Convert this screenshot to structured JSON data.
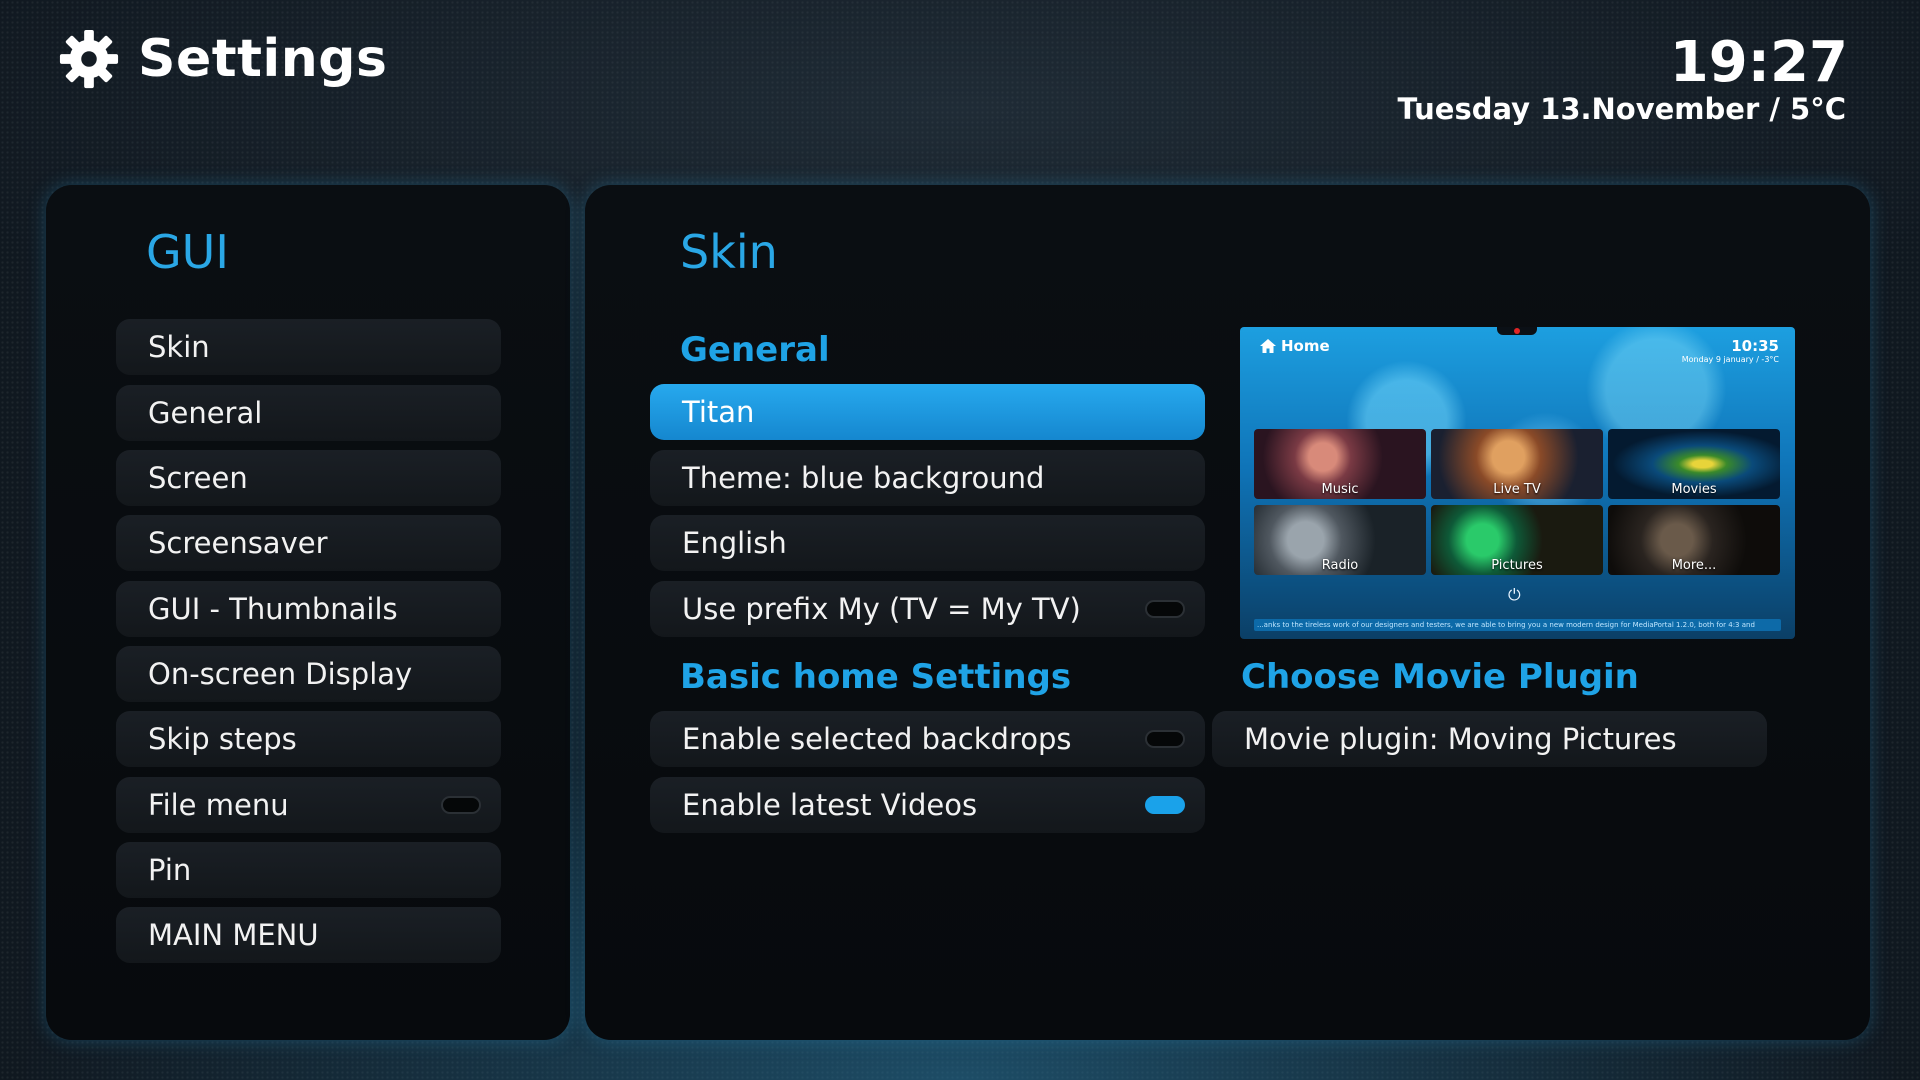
{
  "header": {
    "title": "Settings",
    "icon": "gear-icon",
    "time": "19:27",
    "date": "Tuesday 13.November / 5°C"
  },
  "left_panel": {
    "heading": "GUI",
    "items": [
      {
        "label": "Skin"
      },
      {
        "label": "General"
      },
      {
        "label": "Screen"
      },
      {
        "label": "Screensaver"
      },
      {
        "label": "GUI - Thumbnails"
      },
      {
        "label": "On-screen Display"
      },
      {
        "label": "Skip steps"
      },
      {
        "label": "File menu",
        "toggle": "off"
      },
      {
        "label": "Pin"
      },
      {
        "label": "MAIN MENU"
      }
    ]
  },
  "right_panel": {
    "heading": "Skin",
    "general": {
      "title": "General",
      "items": [
        {
          "label": "Titan",
          "selected": true
        },
        {
          "label": "Theme: blue background"
        },
        {
          "label": "English"
        },
        {
          "label": "Use prefix My (TV = My TV)",
          "toggle": "off"
        }
      ]
    },
    "basic_home": {
      "title": "Basic home Settings",
      "items": [
        {
          "label": "Enable selected backdrops",
          "toggle": "off"
        },
        {
          "label": "Enable latest Videos",
          "toggle": "on"
        }
      ]
    },
    "movie_plugin": {
      "title": "Choose Movie Plugin",
      "items": [
        {
          "label": "Movie plugin: Moving Pictures"
        }
      ]
    },
    "preview": {
      "home_label": "Home",
      "time": "10:35",
      "date": "Monday 9 january / -3°C",
      "tiles": [
        "Music",
        "Live TV",
        "Movies",
        "Radio",
        "Pictures",
        "More..."
      ],
      "ticker": "...anks to the tireless work of our designers and testers, we are able to bring you a new modern design for MediaPortal 1.2.0, both for 4:3 and"
    }
  },
  "colors": {
    "accent": "#1fa3e6",
    "selected": "#1b97de",
    "panel": "#080b0e"
  }
}
